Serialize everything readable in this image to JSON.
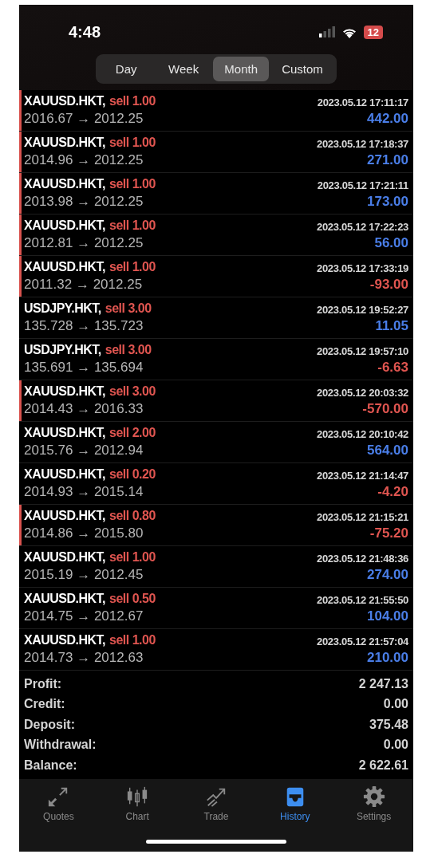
{
  "status_bar": {
    "time": "4:48",
    "battery": "12"
  },
  "period_tabs": [
    {
      "label": "Day",
      "selected": false
    },
    {
      "label": "Week",
      "selected": false
    },
    {
      "label": "Month",
      "selected": true
    },
    {
      "label": "Custom",
      "selected": false
    }
  ],
  "deals": [
    {
      "symbol": "XAUUSD.HKT,",
      "side": "sell 1.00",
      "prices": "2016.67 → 2012.25",
      "time": "2023.05.12 17:11:17",
      "profit": "442.00",
      "loss": false,
      "marked": true
    },
    {
      "symbol": "XAUUSD.HKT,",
      "side": "sell 1.00",
      "prices": "2014.96 → 2012.25",
      "time": "2023.05.12 17:18:37",
      "profit": "271.00",
      "loss": false,
      "marked": true
    },
    {
      "symbol": "XAUUSD.HKT,",
      "side": "sell 1.00",
      "prices": "2013.98 → 2012.25",
      "time": "2023.05.12 17:21:11",
      "profit": "173.00",
      "loss": false,
      "marked": true
    },
    {
      "symbol": "XAUUSD.HKT,",
      "side": "sell 1.00",
      "prices": "2012.81 → 2012.25",
      "time": "2023.05.12 17:22:23",
      "profit": "56.00",
      "loss": false,
      "marked": true
    },
    {
      "symbol": "XAUUSD.HKT,",
      "side": "sell 1.00",
      "prices": "2011.32 → 2012.25",
      "time": "2023.05.12 17:33:19",
      "profit": "-93.00",
      "loss": true,
      "marked": true
    },
    {
      "symbol": "USDJPY.HKT,",
      "side": "sell 3.00",
      "prices": "135.728 → 135.723",
      "time": "2023.05.12 19:52:27",
      "profit": "11.05",
      "loss": false,
      "marked": false
    },
    {
      "symbol": "USDJPY.HKT,",
      "side": "sell 3.00",
      "prices": "135.691 → 135.694",
      "time": "2023.05.12 19:57:10",
      "profit": "-6.63",
      "loss": true,
      "marked": false
    },
    {
      "symbol": "XAUUSD.HKT,",
      "side": "sell 3.00",
      "prices": "2014.43 → 2016.33",
      "time": "2023.05.12 20:03:32",
      "profit": "-570.00",
      "loss": true,
      "marked": true
    },
    {
      "symbol": "XAUUSD.HKT,",
      "side": "sell 2.00",
      "prices": "2015.76 → 2012.94",
      "time": "2023.05.12 20:10:42",
      "profit": "564.00",
      "loss": false,
      "marked": false
    },
    {
      "symbol": "XAUUSD.HKT,",
      "side": "sell 0.20",
      "prices": "2014.93 → 2015.14",
      "time": "2023.05.12 21:14:47",
      "profit": "-4.20",
      "loss": true,
      "marked": false
    },
    {
      "symbol": "XAUUSD.HKT,",
      "side": "sell 0.80",
      "prices": "2014.86 → 2015.80",
      "time": "2023.05.12 21:15:21",
      "profit": "-75.20",
      "loss": true,
      "marked": true
    },
    {
      "symbol": "XAUUSD.HKT,",
      "side": "sell 1.00",
      "prices": "2015.19 → 2012.45",
      "time": "2023.05.12 21:48:36",
      "profit": "274.00",
      "loss": false,
      "marked": false
    },
    {
      "symbol": "XAUUSD.HKT,",
      "side": "sell 0.50",
      "prices": "2014.75 → 2012.67",
      "time": "2023.05.12 21:55:50",
      "profit": "104.00",
      "loss": false,
      "marked": false
    },
    {
      "symbol": "XAUUSD.HKT,",
      "side": "sell 1.00",
      "prices": "2014.73 → 2012.63",
      "time": "2023.05.12 21:57:04",
      "profit": "210.00",
      "loss": false,
      "marked": false
    }
  ],
  "summary": [
    {
      "label": "Profit:",
      "value": "2 247.13"
    },
    {
      "label": "Credit:",
      "value": "0.00"
    },
    {
      "label": "Deposit:",
      "value": "375.48"
    },
    {
      "label": "Withdrawal:",
      "value": "0.00"
    },
    {
      "label": "Balance:",
      "value": "2 622.61"
    }
  ],
  "tab_bar": [
    {
      "label": "Quotes",
      "kind": "quotes",
      "selected": false
    },
    {
      "label": "Chart",
      "kind": "chart",
      "selected": false
    },
    {
      "label": "Trade",
      "kind": "trade",
      "selected": false
    },
    {
      "label": "History",
      "kind": "history",
      "selected": true
    },
    {
      "label": "Settings",
      "kind": "settings",
      "selected": false
    }
  ]
}
